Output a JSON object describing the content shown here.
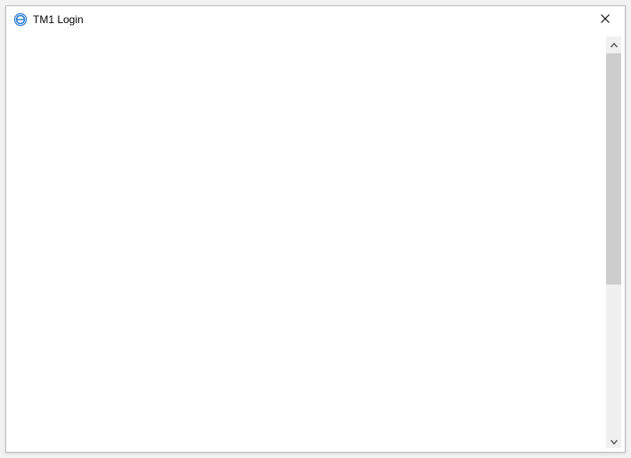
{
  "window": {
    "title": "TM1 Login"
  }
}
